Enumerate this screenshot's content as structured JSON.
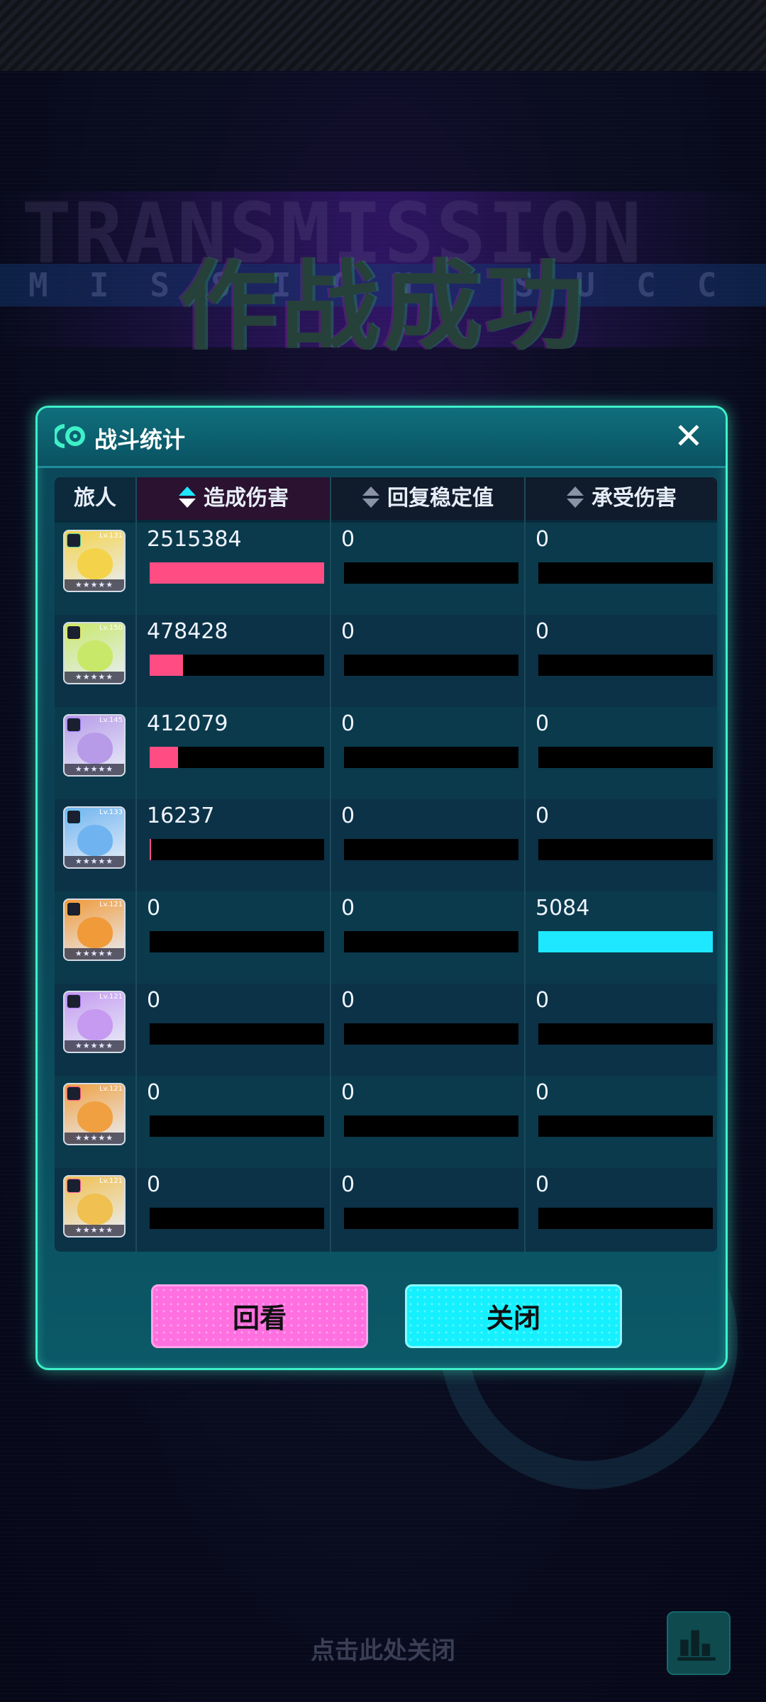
{
  "banner": {
    "title": "作战成功",
    "english_line1": "TRANSMISSION",
    "english_line2": "MISSION SUCCEEDED"
  },
  "panel": {
    "title": "战斗统计",
    "close_icon": "close-icon"
  },
  "table": {
    "headers": {
      "traveler": "旅人",
      "damage_dealt": "造成伤害",
      "stability_restored": "回复稳定值",
      "damage_taken": "承受伤害"
    },
    "rows": [
      {
        "level": "Lv.131",
        "damage_dealt": "2515384",
        "stability_restored": "0",
        "damage_taken": "0",
        "damage_fraction": 1.0,
        "taken_fraction": 0
      },
      {
        "level": "Lv.150",
        "damage_dealt": "478428",
        "stability_restored": "0",
        "damage_taken": "0",
        "damage_fraction": 0.19,
        "taken_fraction": 0
      },
      {
        "level": "Lv.145",
        "damage_dealt": "412079",
        "stability_restored": "0",
        "damage_taken": "0",
        "damage_fraction": 0.164,
        "taken_fraction": 0
      },
      {
        "level": "Lv.133",
        "damage_dealt": "16237",
        "stability_restored": "0",
        "damage_taken": "0",
        "damage_fraction": 0.006,
        "taken_fraction": 0
      },
      {
        "level": "Lv.121",
        "damage_dealt": "0",
        "stability_restored": "0",
        "damage_taken": "5084",
        "damage_fraction": 0,
        "taken_fraction": 1.0
      },
      {
        "level": "Lv.121",
        "damage_dealt": "0",
        "stability_restored": "0",
        "damage_taken": "0",
        "damage_fraction": 0,
        "taken_fraction": 0
      },
      {
        "level": "Lv.121",
        "damage_dealt": "0",
        "stability_restored": "0",
        "damage_taken": "0",
        "damage_fraction": 0,
        "taken_fraction": 0
      },
      {
        "level": "Lv.121",
        "damage_dealt": "0",
        "stability_restored": "0",
        "damage_taken": "0",
        "damage_fraction": 0,
        "taken_fraction": 0
      }
    ]
  },
  "buttons": {
    "replay": "回看",
    "close": "关闭"
  },
  "footer": {
    "tap_to_close": "点击此处关闭",
    "stats_icon": "bar-chart-icon"
  },
  "colors": {
    "accent": "#3ef0c8",
    "damage_bar": "#ff4d84",
    "taken_bar": "#1ee8ff",
    "replay_button": "#ff6fe0",
    "close_button": "#15f0ff"
  }
}
